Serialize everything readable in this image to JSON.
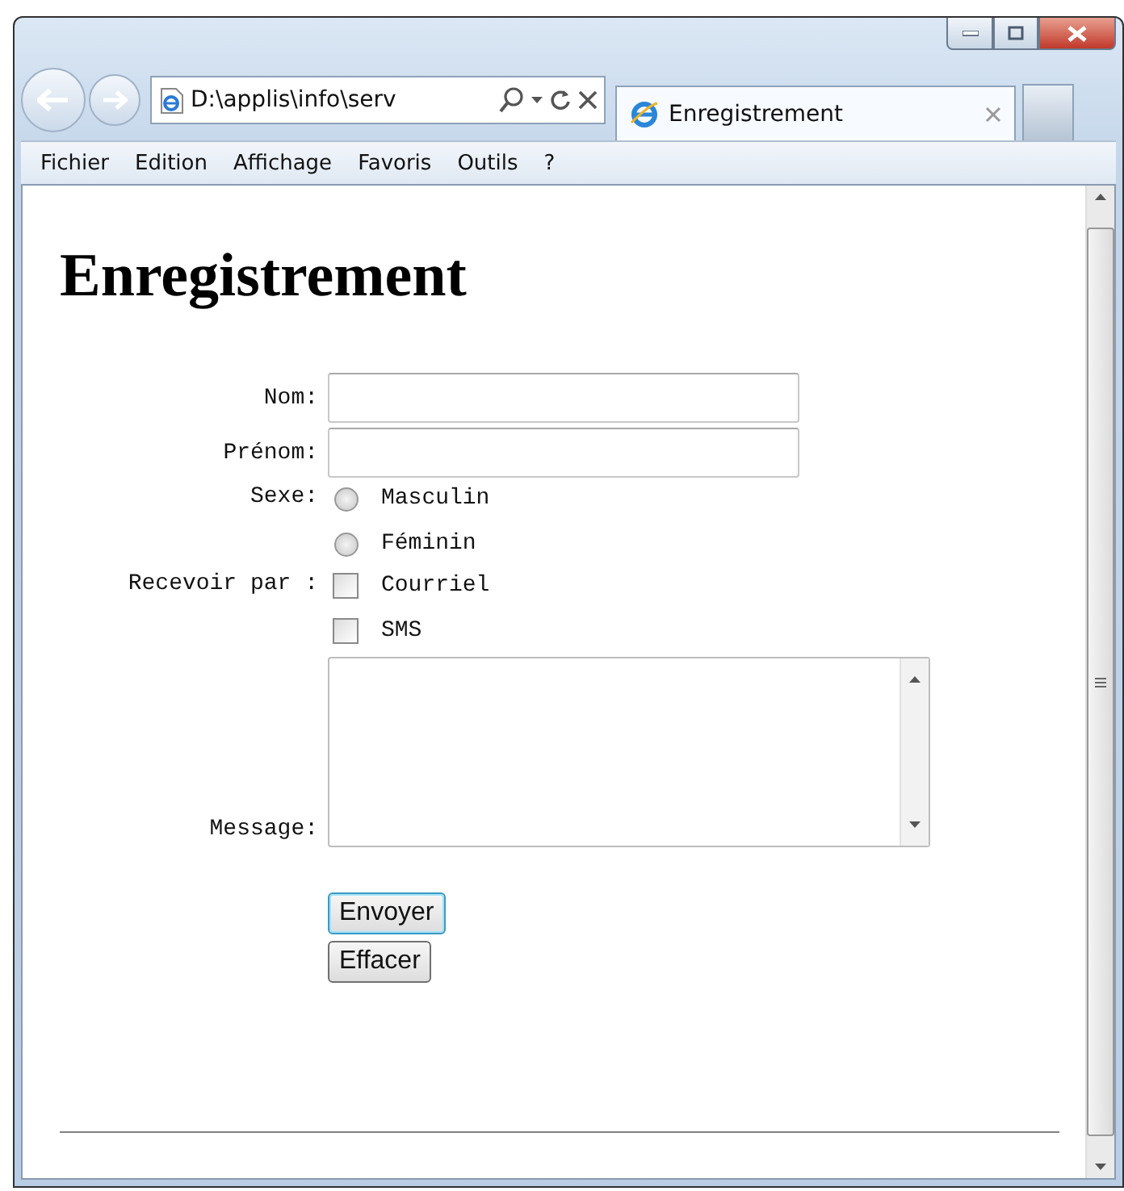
{
  "browser": {
    "address": "D:\\applis\\info\\serv",
    "tab": {
      "title": "Enregistrement",
      "selected": true
    }
  },
  "menu": [
    "Fichier",
    "Edition",
    "Affichage",
    "Favoris",
    "Outils",
    "?"
  ],
  "page": {
    "heading": "Enregistrement",
    "form": [
      {
        "kind": "text",
        "label": "Nom:"
      },
      {
        "kind": "text",
        "label": "Prénom:"
      },
      {
        "kind": "radio",
        "label": "Sexe:",
        "options": [
          {
            "label": "Masculin",
            "selected": false
          },
          {
            "label": "Féminin",
            "selected": false
          }
        ]
      },
      {
        "kind": "checkbox",
        "label": "Recevoir par :",
        "options": [
          {
            "label": "Courriel",
            "checked": false
          },
          {
            "label": "SMS",
            "checked": false
          }
        ]
      },
      {
        "kind": "textarea",
        "label": "Message:"
      }
    ],
    "buttons": [
      {
        "label": "Envoyer",
        "focused": true
      },
      {
        "label": "Effacer",
        "focused": false
      }
    ]
  }
}
